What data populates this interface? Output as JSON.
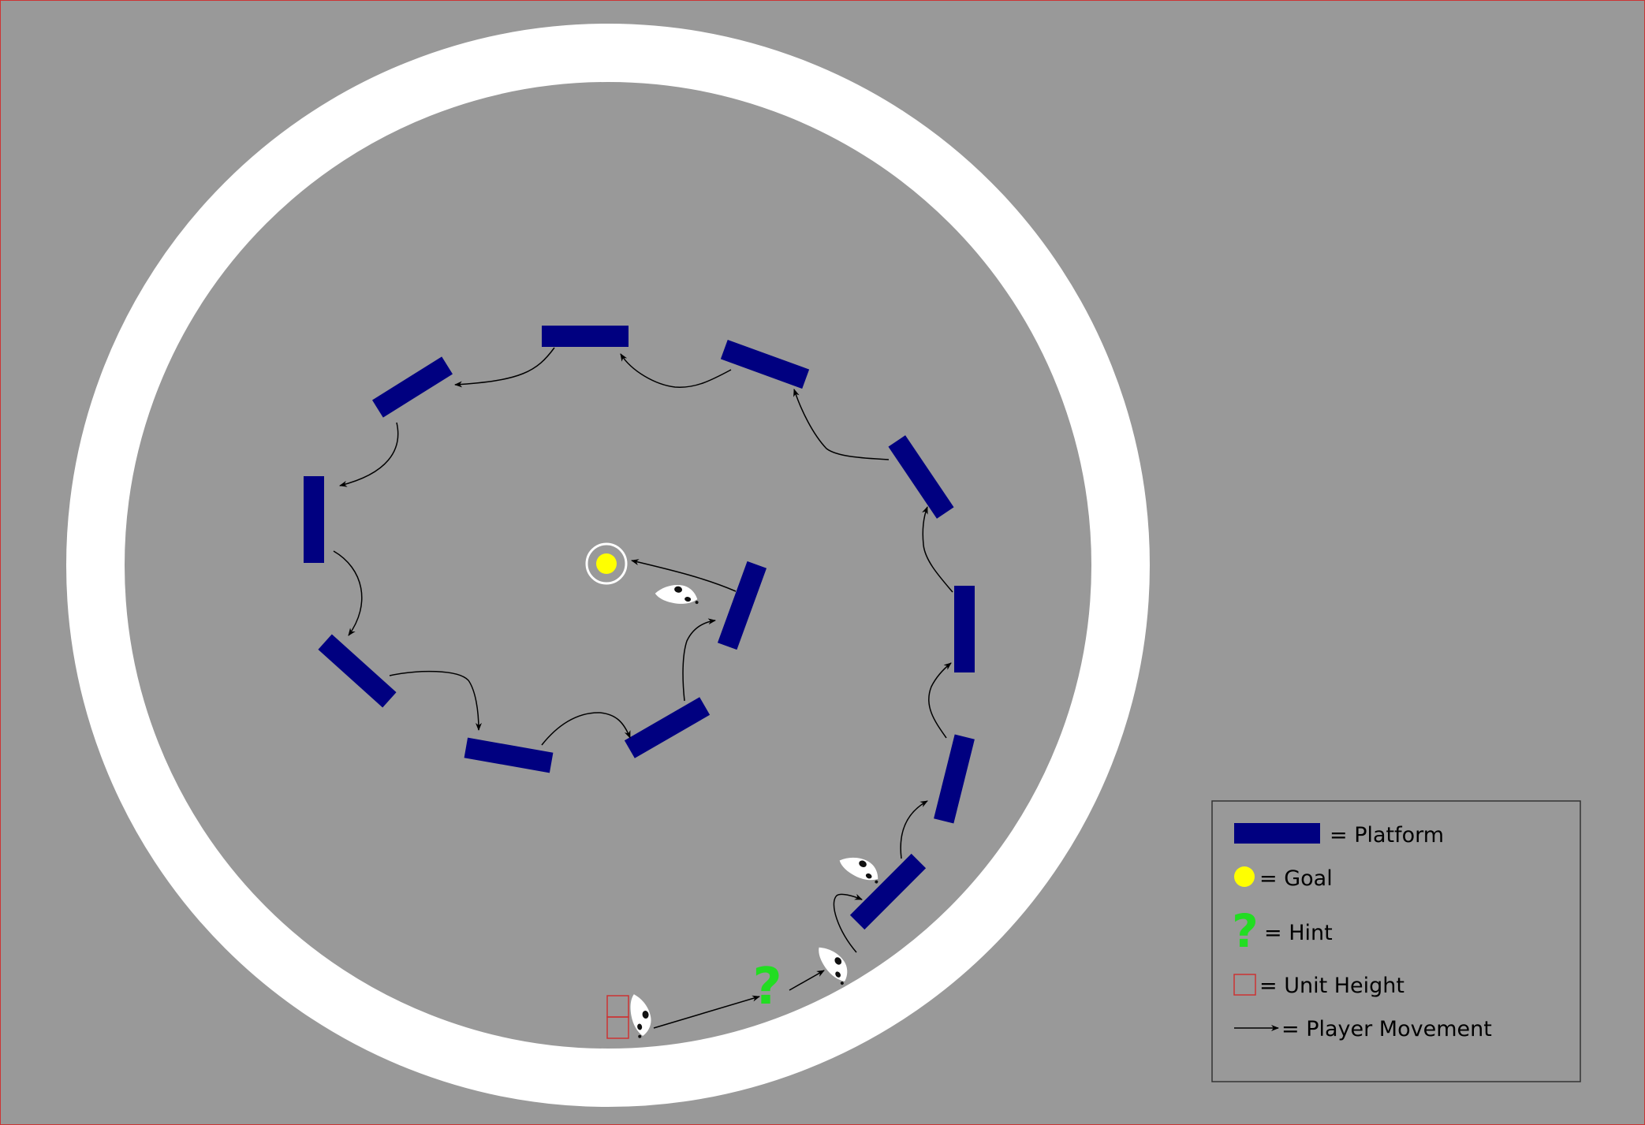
{
  "colors": {
    "background": "#999999",
    "arena_ring": "#ffffff",
    "platform": "#000080",
    "goal": "#ffff00",
    "hint": "#22dd22",
    "unit_height": "#cc3333",
    "movement": "#000000"
  },
  "legend": {
    "platform": "= Platform",
    "goal": "= Goal",
    "hint": "= Hint",
    "unit_height": "= Unit Height",
    "player_movement": "= Player Movement"
  },
  "hint_symbol": "?",
  "icons": {
    "player": "player-mouse-icon",
    "goal": "goal-icon",
    "hint": "hint-question-icon",
    "unit_height": "unit-height-box-icon"
  }
}
